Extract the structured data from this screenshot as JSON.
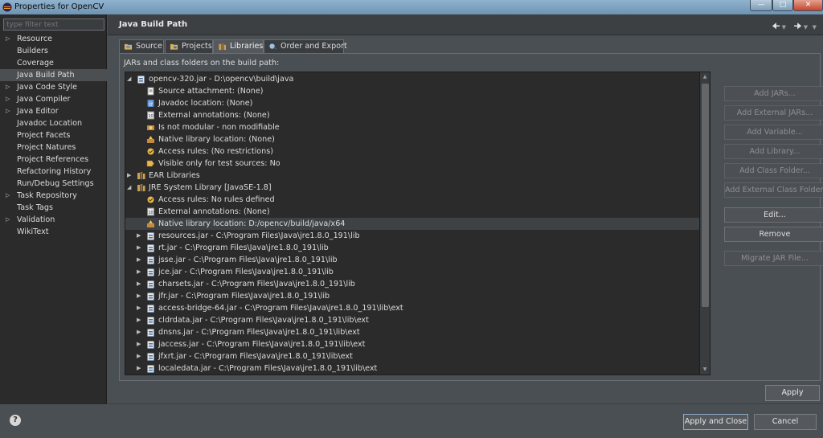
{
  "window": {
    "title": "Properties for OpenCV"
  },
  "filter": {
    "placeholder": "type filter text"
  },
  "nav": {
    "items": [
      {
        "label": "Resource",
        "expandable": true,
        "selected": false
      },
      {
        "label": "Builders",
        "expandable": false,
        "selected": false
      },
      {
        "label": "Coverage",
        "expandable": false,
        "selected": false
      },
      {
        "label": "Java Build Path",
        "expandable": false,
        "selected": true
      },
      {
        "label": "Java Code Style",
        "expandable": true,
        "selected": false
      },
      {
        "label": "Java Compiler",
        "expandable": true,
        "selected": false
      },
      {
        "label": "Java Editor",
        "expandable": true,
        "selected": false
      },
      {
        "label": "Javadoc Location",
        "expandable": false,
        "selected": false
      },
      {
        "label": "Project Facets",
        "expandable": false,
        "selected": false
      },
      {
        "label": "Project Natures",
        "expandable": false,
        "selected": false
      },
      {
        "label": "Project References",
        "expandable": false,
        "selected": false
      },
      {
        "label": "Refactoring History",
        "expandable": false,
        "selected": false
      },
      {
        "label": "Run/Debug Settings",
        "expandable": false,
        "selected": false
      },
      {
        "label": "Task Repository",
        "expandable": true,
        "selected": false
      },
      {
        "label": "Task Tags",
        "expandable": false,
        "selected": false
      },
      {
        "label": "Validation",
        "expandable": true,
        "selected": false
      },
      {
        "label": "WikiText",
        "expandable": false,
        "selected": false
      }
    ]
  },
  "header": {
    "title": "Java Build Path"
  },
  "tabs": [
    {
      "label": "Source",
      "icon": "source-folder-icon",
      "active": false
    },
    {
      "label": "Projects",
      "icon": "projects-icon",
      "active": false
    },
    {
      "label": "Libraries",
      "icon": "libraries-icon",
      "active": true
    },
    {
      "label": "Order and Export",
      "icon": "order-export-icon",
      "active": false
    }
  ],
  "libraries": {
    "subtitle": "JARs and class folders on the build path:",
    "tree": [
      {
        "label": "opencv-320.jar - D:\\opencv\\build\\java",
        "level": 0,
        "twisty": "open",
        "icon": "jar-icon"
      },
      {
        "label": "Source attachment: (None)",
        "level": 1,
        "icon": "source-attachment-icon"
      },
      {
        "label": "Javadoc location: (None)",
        "level": 1,
        "icon": "javadoc-icon"
      },
      {
        "label": "External annotations: (None)",
        "level": 1,
        "icon": "annotations-icon"
      },
      {
        "label": "Is not modular - non modifiable",
        "level": 1,
        "icon": "module-icon"
      },
      {
        "label": "Native library location: (None)",
        "level": 1,
        "icon": "native-library-icon"
      },
      {
        "label": "Access rules: (No restrictions)",
        "level": 1,
        "icon": "access-rules-icon"
      },
      {
        "label": "Visible only for test sources: No",
        "level": 1,
        "icon": "test-sources-icon"
      },
      {
        "label": "EAR Libraries",
        "level": 0,
        "twisty": "closed",
        "icon": "library-icon"
      },
      {
        "label": "JRE System Library [JavaSE-1.8]",
        "level": 0,
        "twisty": "open",
        "icon": "library-icon"
      },
      {
        "label": "Access rules: No rules defined",
        "level": 1,
        "icon": "access-rules-icon"
      },
      {
        "label": "External annotations: (None)",
        "level": 1,
        "icon": "annotations-icon"
      },
      {
        "label": "Native library location: D:/opencv/build/java/x64",
        "level": 1,
        "icon": "native-library-icon",
        "highlight": true
      },
      {
        "label": "resources.jar - C:\\Program Files\\Java\\jre1.8.0_191\\lib",
        "level": 1,
        "twisty": "closed",
        "icon": "jar-icon"
      },
      {
        "label": "rt.jar - C:\\Program Files\\Java\\jre1.8.0_191\\lib",
        "level": 1,
        "twisty": "closed",
        "icon": "jar-icon"
      },
      {
        "label": "jsse.jar - C:\\Program Files\\Java\\jre1.8.0_191\\lib",
        "level": 1,
        "twisty": "closed",
        "icon": "jar-icon"
      },
      {
        "label": "jce.jar - C:\\Program Files\\Java\\jre1.8.0_191\\lib",
        "level": 1,
        "twisty": "closed",
        "icon": "jar-icon"
      },
      {
        "label": "charsets.jar - C:\\Program Files\\Java\\jre1.8.0_191\\lib",
        "level": 1,
        "twisty": "closed",
        "icon": "jar-icon"
      },
      {
        "label": "jfr.jar - C:\\Program Files\\Java\\jre1.8.0_191\\lib",
        "level": 1,
        "twisty": "closed",
        "icon": "jar-icon"
      },
      {
        "label": "access-bridge-64.jar - C:\\Program Files\\Java\\jre1.8.0_191\\lib\\ext",
        "level": 1,
        "twisty": "closed",
        "icon": "jar-icon"
      },
      {
        "label": "cldrdata.jar - C:\\Program Files\\Java\\jre1.8.0_191\\lib\\ext",
        "level": 1,
        "twisty": "closed",
        "icon": "jar-icon"
      },
      {
        "label": "dnsns.jar - C:\\Program Files\\Java\\jre1.8.0_191\\lib\\ext",
        "level": 1,
        "twisty": "closed",
        "icon": "jar-icon"
      },
      {
        "label": "jaccess.jar - C:\\Program Files\\Java\\jre1.8.0_191\\lib\\ext",
        "level": 1,
        "twisty": "closed",
        "icon": "jar-icon"
      },
      {
        "label": "jfxrt.jar - C:\\Program Files\\Java\\jre1.8.0_191\\lib\\ext",
        "level": 1,
        "twisty": "closed",
        "icon": "jar-icon"
      },
      {
        "label": "localedata.jar - C:\\Program Files\\Java\\jre1.8.0_191\\lib\\ext",
        "level": 1,
        "twisty": "closed",
        "icon": "jar-icon"
      }
    ],
    "buttons": {
      "add_jars": "Add JARs...",
      "add_external_jars": "Add External JARs...",
      "add_variable": "Add Variable...",
      "add_library": "Add Library...",
      "add_class_folder": "Add Class Folder...",
      "add_external_class_folder": "Add External Class Folder...",
      "edit": "Edit...",
      "remove": "Remove",
      "migrate_jar": "Migrate JAR File..."
    }
  },
  "footer": {
    "apply": "Apply",
    "apply_and_close": "Apply and Close",
    "cancel": "Cancel",
    "help": "?"
  },
  "colors": {
    "selection": "#4c4f52",
    "tree_bg": "#2b2b2b",
    "panel_bg": "#4a4f53"
  }
}
